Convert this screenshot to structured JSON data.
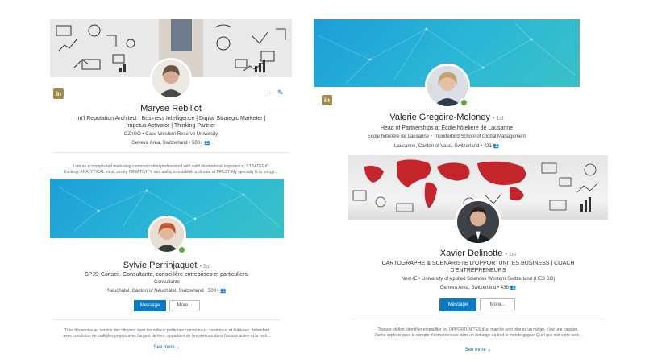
{
  "brand": {
    "li_label": "in",
    "accent": "#0a7bc2",
    "online": "#5fa83a"
  },
  "cards": {
    "maryse": {
      "name": "Maryse Rebillot",
      "headline_1": "Int'l Reputation Architect | Business Intelligence | Digital Strategic Marketer |",
      "headline_2": "Impetus Activator | Thinking Partner",
      "education": "OZnGO • Case Western Reserve University",
      "location": "Geneva Area, Switzerland • 500+",
      "more_icon": "⋯",
      "edit_icon": "✎",
      "summary_1": "I am an accomplished marketing-communication professional with solid international experience, STRATEGIC",
      "summary_2": "thinking, ANALYTICAL mind, strong CREATIVITY, and ability to establish a climate of TRUST. My specialty is to bring i..."
    },
    "sylvie": {
      "name": "Sylvie Perrinjaquet",
      "degree": "• 1st",
      "headline": "SPJS-Conseil. Consultante, conseillère entreprises et particuliers.",
      "role": "Consultante",
      "location": "Neuchâtel, Canton of Neuchâtel, Switzerland • 500+",
      "message": "Message",
      "more": "More...",
      "summary_1": "Trois décennies au service des citoyens dans les milieux politiques communaux, cantonaux et fédéraux, défendant",
      "summary_2": "avec conviction de multiples projets avec l'argent de tiers, appartient de l'expérience dans l'écoute active et la rech...",
      "see_more": "See more"
    },
    "valerie": {
      "name": "Valerie Gregoire-Moloney",
      "degree": "• 1st",
      "headline": "Head of Partnerships at Ecole hôtelière de Lausanne",
      "education": "Ecole hôtelière de Lausanne • Thunderbird School of Global Management",
      "location": "Lausanne, Canton of Vaud, Switzerland • 421"
    },
    "xavier": {
      "name": "Xavier Delinotte",
      "degree": "• 1st",
      "headline_1": "CARTOGRAPHE & SCENARISTE D'OPPORTUNITES BUSINESS | COACH",
      "headline_2": "D'ENTREPRENEURS",
      "education": "Next-IE • University of Applied Sciences Western Switzerland (HES SO)",
      "location": "Geneva Area, Switzerland • 439",
      "message": "Message",
      "more": "More...",
      "summary_1": "Traquer, définir, identifier et qualifier les OPPORTUNITES d'un marché sont plus qu'un métier, c'est une passion.",
      "summary_2": "J'aime explorer pour le compte d'entrepreneurs dans un échange où tout le monde gagne. Quel que soit votre sect...",
      "see_more": "See more"
    }
  },
  "icons": {
    "people": "👥",
    "chevron": "⌄"
  }
}
